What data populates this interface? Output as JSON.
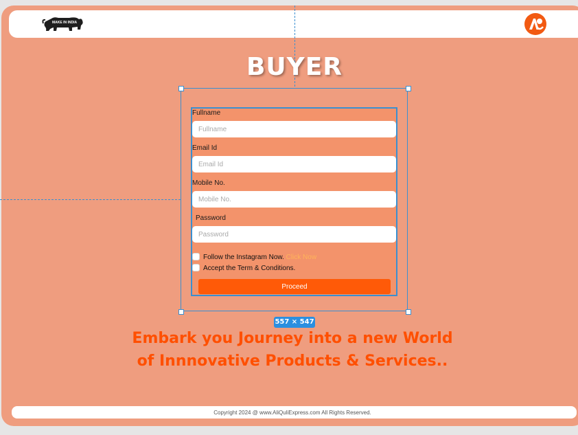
{
  "header": {
    "logo_left_text": "MAKE IN INDIA",
    "logo_right_icon": "aliquli-logo-icon"
  },
  "page_title": "BUYER",
  "form": {
    "fullname": {
      "label": "Fullname",
      "placeholder": "Fullname"
    },
    "email": {
      "label": "Email Id",
      "placeholder": "Email Id"
    },
    "mobile": {
      "label": "Mobile No.",
      "placeholder": "Mobile No."
    },
    "password": {
      "label": "Password",
      "placeholder": "Password"
    },
    "instagram_check": {
      "label": "Follow the Instagram Now.",
      "link": "Click Now"
    },
    "terms_check": {
      "label": "Accept the Term & Conditions."
    },
    "proceed_label": "Proceed"
  },
  "selection_badge": "557 × 547",
  "tagline": {
    "line1": "Embark you Journey into a new World",
    "line2": "of Innnovative Products & Services.."
  },
  "footer": {
    "copyright": "Copyright 2024 @ www.AliQuliExpress.com  All Rights Reserved."
  },
  "colors": {
    "page_bg": "#ef9d7f",
    "form_bg": "#f3936b",
    "accent": "#ff5a08",
    "selection": "#3a8fd0"
  }
}
